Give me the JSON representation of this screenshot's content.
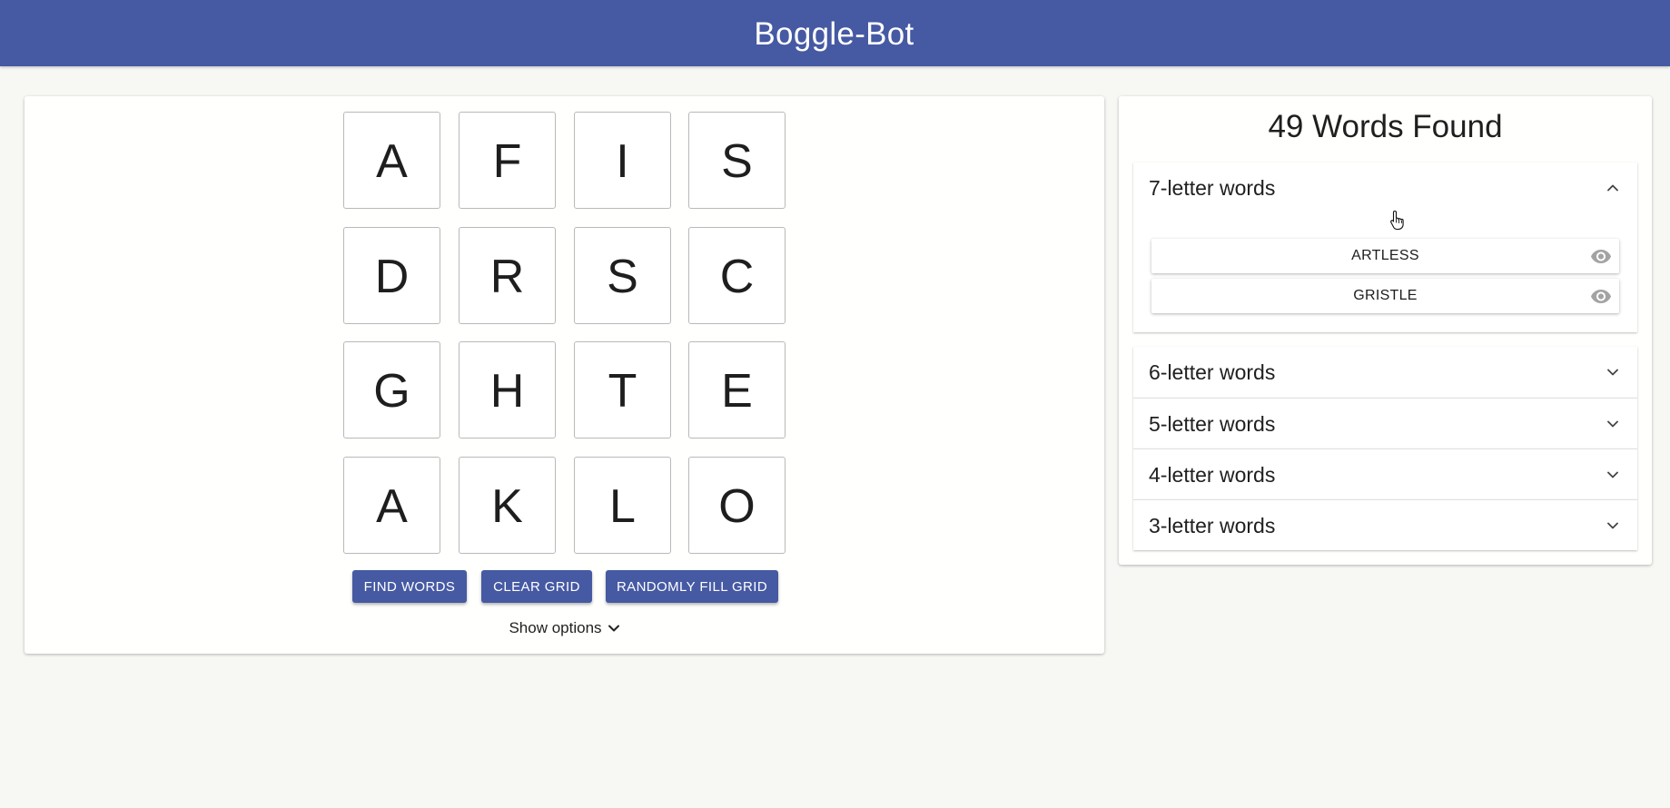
{
  "app": {
    "title": "Boggle-Bot"
  },
  "grid": {
    "rows": [
      [
        "A",
        "F",
        "I",
        "S"
      ],
      [
        "D",
        "R",
        "S",
        "C"
      ],
      [
        "G",
        "H",
        "T",
        "E"
      ],
      [
        "A",
        "K",
        "L",
        "O"
      ]
    ]
  },
  "actions": {
    "find_words": "FIND WORDS",
    "clear_grid": "CLEAR GRID",
    "randomly_fill": "RANDOMLY FILL GRID",
    "show_options": "Show options"
  },
  "results": {
    "title": "49 Words Found",
    "groups": [
      {
        "label": "7-letter words",
        "expanded": true,
        "words": [
          "ARTLESS",
          "GRISTLE"
        ]
      },
      {
        "label": "6-letter words",
        "expanded": false
      },
      {
        "label": "5-letter words",
        "expanded": false
      },
      {
        "label": "4-letter words",
        "expanded": false
      },
      {
        "label": "3-letter words",
        "expanded": false
      }
    ]
  },
  "icons": {
    "reveal": "eye-icon",
    "expand": "chevron-down-icon",
    "collapse": "chevron-up-icon",
    "cursor": "hand-pointer-icon"
  },
  "colors": {
    "primary": "#4659a3",
    "background": "#f7f7f4",
    "card": "#fffffd",
    "icon_grey": "#9e9e9e"
  }
}
